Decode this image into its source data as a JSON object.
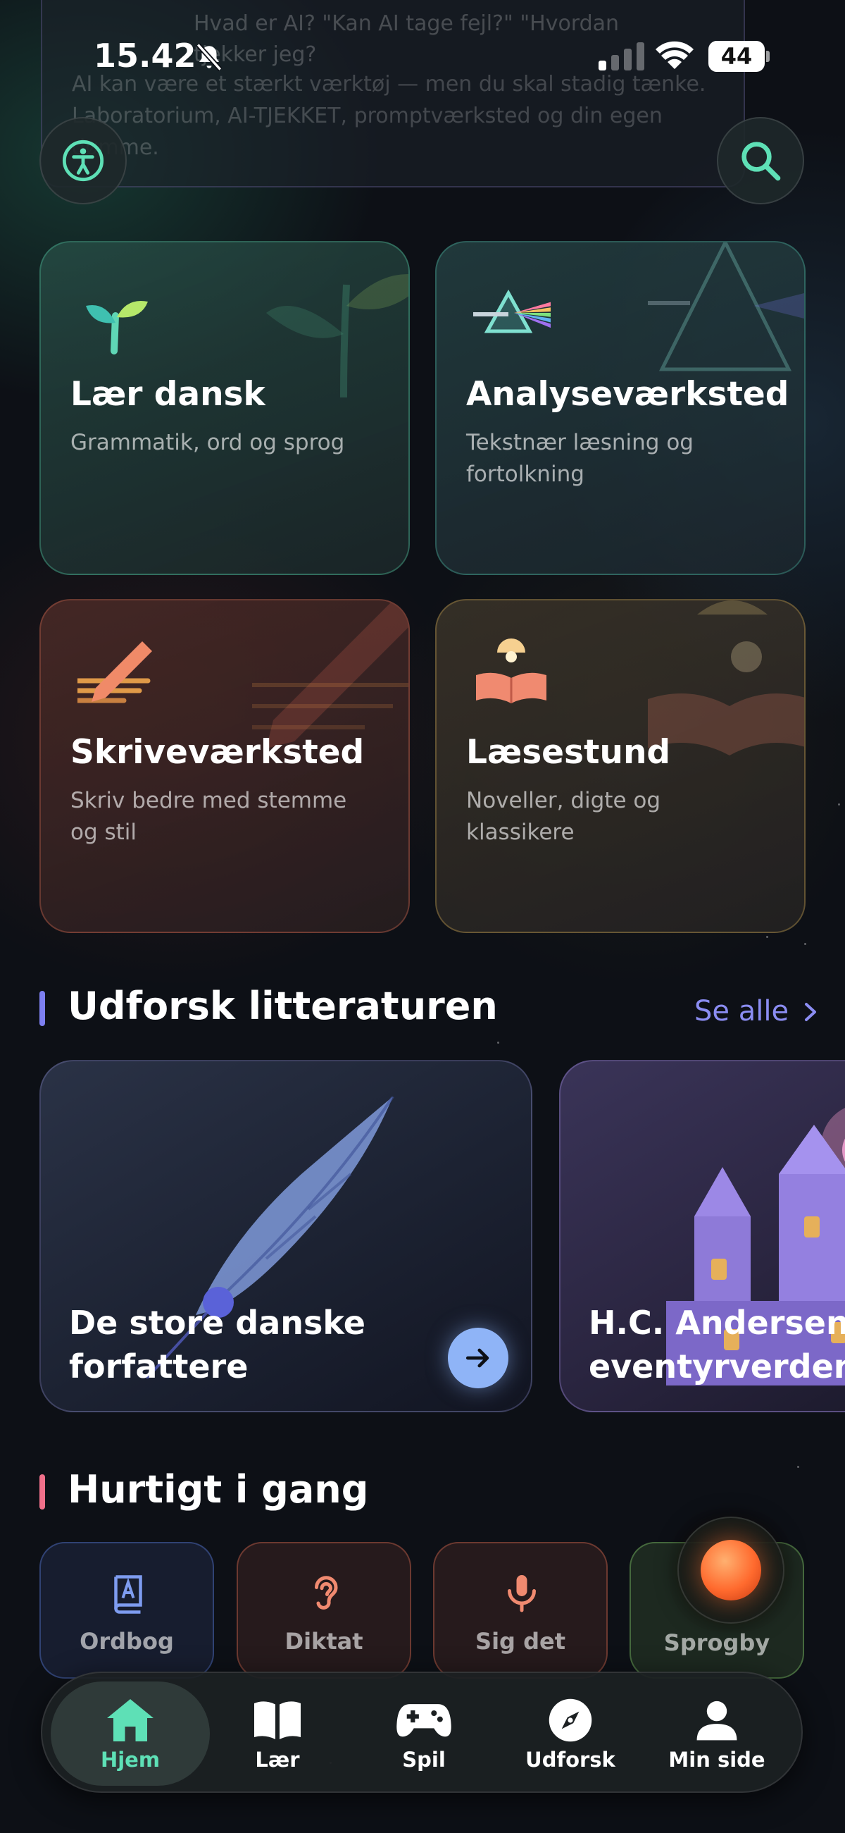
{
  "status_bar": {
    "time": "15.42",
    "battery": "44"
  },
  "top_card": {
    "question_text": "Hvad er AI? \"Kan AI tage fejl?\" \"Hvordan tjekker jeg?",
    "description": "AI kan være et stærkt værktøj — men du skal stadig tænke. Laboratorium, AI-TJEKKET, promptværksted og din egen dømme."
  },
  "top_buttons": {
    "accessibility_icon": "accessibility-icon",
    "search_icon": "search-icon"
  },
  "categories": [
    {
      "title": "Lær dansk",
      "subtitle": "Grammatik, ord og sprog",
      "icon": "sprout-icon",
      "color": "#5fd6b5"
    },
    {
      "title": "Analyseværksted",
      "subtitle": "Tekstnær læsning og fortolkning",
      "icon": "prism-icon",
      "color": "#7fe0d0"
    },
    {
      "title": "Skriveværksted",
      "subtitle": "Skriv bedre med stemme og stil",
      "icon": "pencil-icon",
      "color": "#f08a68"
    },
    {
      "title": "Læsestund",
      "subtitle": "Noveller, digte og klassikere",
      "icon": "open-book-icon",
      "color": "#f0a080"
    }
  ],
  "literature": {
    "heading": "Udforsk litteraturen",
    "see_all": "Se alle",
    "bar_color": "#7d7ff0",
    "cards": [
      {
        "title": "De store danske forfattere",
        "icon": "quill-icon"
      },
      {
        "title": "H.C. Andersens eventyrverden",
        "icon": "castle-icon"
      }
    ]
  },
  "quick_start": {
    "heading": "Hurtigt i gang",
    "bar_color": "#f0708a",
    "tiles": [
      {
        "label": "Ordbog",
        "icon": "dictionary-icon",
        "color": "#7e9cf0"
      },
      {
        "label": "Diktat",
        "icon": "ear-icon",
        "color": "#f08a70"
      },
      {
        "label": "Sig det",
        "icon": "microphone-icon",
        "color": "#f08a70"
      },
      {
        "label": "Sprogby",
        "icon": "orb-icon",
        "color": "#ff6a2e"
      }
    ]
  },
  "tabbar": {
    "active_color": "#5ee0b6",
    "tabs": [
      {
        "label": "Hjem",
        "icon": "home-icon",
        "active": true
      },
      {
        "label": "Lær",
        "icon": "book-icon",
        "active": false
      },
      {
        "label": "Spil",
        "icon": "gamepad-icon",
        "active": false
      },
      {
        "label": "Udforsk",
        "icon": "compass-icon",
        "active": false
      },
      {
        "label": "Min side",
        "icon": "person-icon",
        "active": false
      }
    ]
  }
}
